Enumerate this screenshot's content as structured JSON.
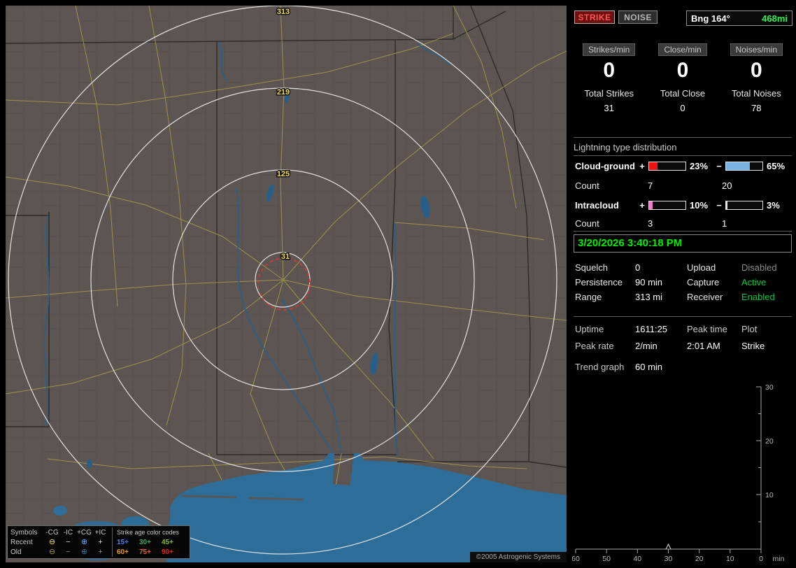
{
  "map": {
    "ring_labels": [
      "313",
      "219",
      "125",
      "31"
    ],
    "legend": {
      "symbols_header": "Symbols",
      "columns": [
        "-CG",
        "-IC",
        "+CG",
        "+IC"
      ],
      "age_header": "Strike age color codes",
      "recent_label": "Recent",
      "old_label": "Old",
      "symbols_recent": [
        "⊖",
        "−",
        "⊕",
        "+"
      ],
      "symbols_old": [
        "⊖",
        "−",
        "⊕",
        "+"
      ],
      "recent_ages": [
        {
          "label": "15+",
          "color": "#5578ee"
        },
        {
          "label": "30+",
          "color": "#33aa66"
        },
        {
          "label": "45+",
          "color": "#8ab82e"
        }
      ],
      "old_ages": [
        {
          "label": "60+",
          "color": "#e89a22"
        },
        {
          "label": "75+",
          "color": "#e86222"
        },
        {
          "label": "90+",
          "color": "#e82222"
        }
      ]
    },
    "copyright": "©2005 Astrogenic Systems"
  },
  "sidebar": {
    "strike_button": "STRIKE",
    "noise_button": "NOISE",
    "bearing_label": "Bng 164°",
    "bearing_distance": "468mi",
    "rates": [
      {
        "label": "Strikes/min",
        "value": "0",
        "total_label": "Total Strikes",
        "total_value": "31"
      },
      {
        "label": "Close/min",
        "value": "0",
        "total_label": "Total Close",
        "total_value": "0"
      },
      {
        "label": "Noises/min",
        "value": "0",
        "total_label": "Total Noises",
        "total_value": "78"
      }
    ],
    "distribution": {
      "title": "Lightning type distribution",
      "plus": "+",
      "minus": "−",
      "rows": [
        {
          "label": "Cloud-ground",
          "pos_pct": "23%",
          "pos_fill": 23,
          "pos_color": "#ee1111",
          "neg_pct": "65%",
          "neg_fill": 65,
          "neg_color": "#7ab2e0",
          "count_label": "Count",
          "pos_count": "7",
          "neg_count": "20"
        },
        {
          "label": "Intracloud",
          "pos_pct": "10%",
          "pos_fill": 10,
          "pos_color": "#ee7ac8",
          "neg_pct": "3%",
          "neg_fill": 3,
          "neg_color": "#e8e8e8",
          "count_label": "Count",
          "pos_count": "3",
          "neg_count": "1"
        }
      ]
    },
    "timestamp": "3/20/2026 3:40:18 PM",
    "settings": {
      "squelch_label": "Squelch",
      "squelch_value": "0",
      "persistence_label": "Persistence",
      "persistence_value": "90 min",
      "range_label": "Range",
      "range_value": "313 mi",
      "upload_label": "Upload",
      "upload_value": "Disabled",
      "capture_label": "Capture",
      "capture_value": "Active",
      "receiver_label": "Receiver",
      "receiver_value": "Enabled"
    },
    "status": {
      "uptime_label": "Uptime",
      "uptime_value": "1611:25",
      "peak_time_label": "Peak time",
      "peak_time_value": "2:01 AM",
      "plot_label": "Plot",
      "plot_value": "Strike",
      "peak_rate_label": "Peak rate",
      "peak_rate_value": "2/min",
      "trend_label": "Trend graph",
      "trend_value": "60 min"
    },
    "trend_chart": {
      "y_ticks": [
        "30",
        "20",
        "10"
      ],
      "x_ticks": [
        "60",
        "50",
        "40",
        "30",
        "20",
        "10",
        "0"
      ],
      "x_unit": "min"
    }
  },
  "colors": {
    "strike_red": "#ff3333",
    "active_green": "#00cc44",
    "timestamp_green": "#00ee00",
    "bearing_green": "#33ee55",
    "disabled_gray": "#8a8a8a"
  }
}
